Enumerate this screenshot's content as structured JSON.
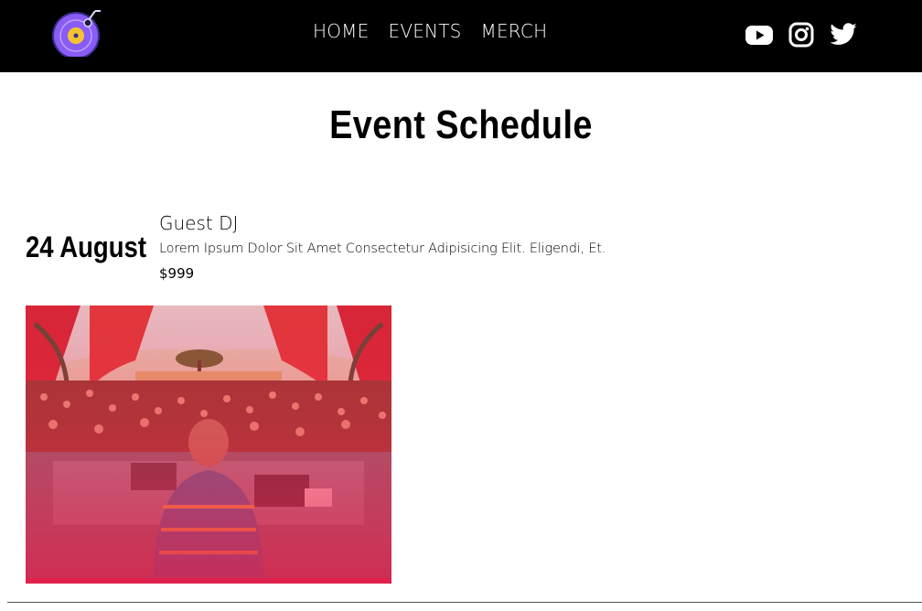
{
  "nav": {
    "logo": "vinyl-record-logo",
    "links": [
      "HOME",
      "EVENTS",
      "MERCH"
    ],
    "social_icons": [
      "youtube-icon",
      "instagram-icon",
      "twitter-icon"
    ]
  },
  "page": {
    "title": "Event Schedule"
  },
  "event": {
    "date": "24 August",
    "name": "Guest DJ",
    "description": "Lorem Ipsum Dolor Sit Amet Consectetur Adipisicing Elit. Eligendi, Et.",
    "price": "$999",
    "image": "dj-crowd-photo"
  },
  "colors": {
    "navbar": "#000000",
    "nav_text": "#ffffff",
    "image_overlay": "#e0214d",
    "logo_purple": "#8a5cf6",
    "logo_yellow": "#f4c430"
  }
}
